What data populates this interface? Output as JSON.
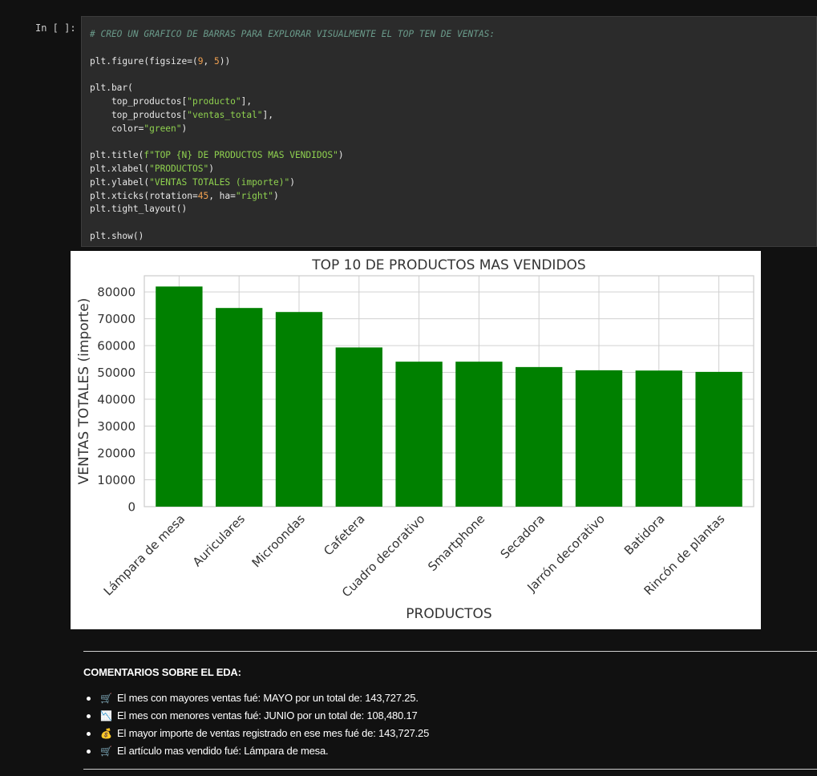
{
  "cell": {
    "prompt": "In [ ]:",
    "code_lines": [
      [
        {
          "t": "cm",
          "v": "# CREO UN GRAFICO DE BARRAS PARA EXPLORAR VISUALMENTE EL TOP TEN DE VENTAS:"
        }
      ],
      [
        {
          "t": "",
          "v": ""
        }
      ],
      [
        {
          "t": "",
          "v": "plt.figure(figsize=("
        },
        {
          "t": "nm",
          "v": "9"
        },
        {
          "t": "",
          "v": ", "
        },
        {
          "t": "nm",
          "v": "5"
        },
        {
          "t": "",
          "v": "))"
        }
      ],
      [
        {
          "t": "",
          "v": ""
        }
      ],
      [
        {
          "t": "",
          "v": "plt.bar("
        }
      ],
      [
        {
          "t": "",
          "v": "    top_productos["
        },
        {
          "t": "st",
          "v": "\"producto\""
        },
        {
          "t": "",
          "v": "],"
        }
      ],
      [
        {
          "t": "",
          "v": "    top_productos["
        },
        {
          "t": "st",
          "v": "\"ventas_total\""
        },
        {
          "t": "",
          "v": "],"
        }
      ],
      [
        {
          "t": "",
          "v": "    color="
        },
        {
          "t": "st",
          "v": "\"green\""
        },
        {
          "t": "",
          "v": ")"
        }
      ],
      [
        {
          "t": "",
          "v": ""
        }
      ],
      [
        {
          "t": "",
          "v": "plt.title("
        },
        {
          "t": "st",
          "v": "f\"TOP {N} DE PRODUCTOS MAS VENDIDOS\""
        },
        {
          "t": "",
          "v": ")"
        }
      ],
      [
        {
          "t": "",
          "v": "plt.xlabel("
        },
        {
          "t": "st",
          "v": "\"PRODUCTOS\""
        },
        {
          "t": "",
          "v": ")"
        }
      ],
      [
        {
          "t": "",
          "v": "plt.ylabel("
        },
        {
          "t": "st",
          "v": "\"VENTAS TOTALES (importe)\""
        },
        {
          "t": "",
          "v": ")"
        }
      ],
      [
        {
          "t": "",
          "v": "plt.xticks(rotation="
        },
        {
          "t": "nm",
          "v": "45"
        },
        {
          "t": "",
          "v": ", ha="
        },
        {
          "t": "st",
          "v": "\"right\""
        },
        {
          "t": "",
          "v": ")"
        }
      ],
      [
        {
          "t": "",
          "v": "plt.tight_layout()"
        }
      ],
      [
        {
          "t": "",
          "v": ""
        }
      ],
      [
        {
          "t": "",
          "v": "plt.show()"
        }
      ]
    ]
  },
  "chart_data": {
    "type": "bar",
    "title": "TOP 10 DE PRODUCTOS MAS VENDIDOS",
    "xlabel": "PRODUCTOS",
    "ylabel": "VENTAS TOTALES (importe)",
    "categories": [
      "Lámpara de mesa",
      "Auriculares",
      "Microondas",
      "Cafetera",
      "Cuadro decorativo",
      "Smartphone",
      "Secadora",
      "Jarrón decorativo",
      "Batidora",
      "Rincón de plantas"
    ],
    "values": [
      82000,
      74000,
      72500,
      59300,
      54000,
      54000,
      52000,
      50800,
      50700,
      50200
    ],
    "yticks": [
      0,
      10000,
      20000,
      30000,
      40000,
      50000,
      60000,
      70000,
      80000
    ],
    "ylim": [
      0,
      86000
    ],
    "bar_color": "#008000",
    "grid": true
  },
  "comments": {
    "title": "COMENTARIOS SOBRE EL EDA:",
    "items": [
      {
        "icon": "shopping-cart-icon",
        "glyph": "🛒",
        "text": "El mes con mayores ventas fué: MAYO por un total de: 143,727.25."
      },
      {
        "icon": "chart-decreasing-icon",
        "glyph": "📉",
        "text": "El mes con menores ventas fué: JUNIO por un total de: 108,480.17"
      },
      {
        "icon": "money-bag-icon",
        "glyph": "💰",
        "text": "El mayor importe de ventas registrado en ese mes fué de: 143,727.25"
      },
      {
        "icon": "shopping-cart-icon",
        "glyph": "🛒",
        "text": "El artículo mas vendido fué: Lámpara de mesa."
      }
    ]
  }
}
